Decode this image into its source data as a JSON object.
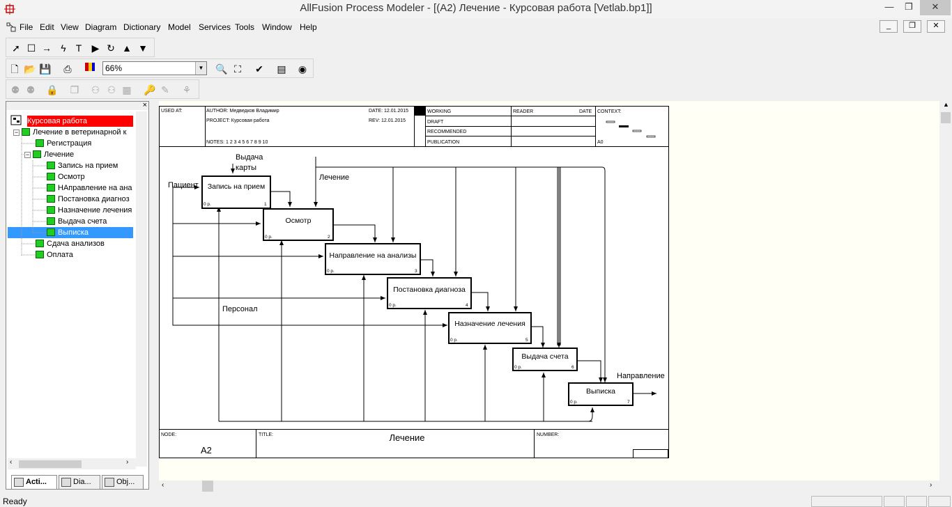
{
  "window": {
    "title": "AllFusion Process Modeler - [(A2) Лечение - Курсовая работа  [Vetlab.bp1]]",
    "minimize": "—",
    "restore": "❐",
    "close": "✕"
  },
  "menu": {
    "items": [
      "File",
      "Edit",
      "View",
      "Diagram",
      "Dictionary",
      "Model",
      "Services",
      "Tools",
      "Window",
      "Help"
    ]
  },
  "mdi": {
    "minimize": "_",
    "restore": "❐",
    "close": "✕"
  },
  "toolbar": {
    "zoom_value": "66%"
  },
  "left_panel": {
    "close": "×",
    "tree": [
      "Курсовая работа",
      "Лечение в ветеринарной к",
      "Регистрация",
      "Лечение",
      "Запись на прием",
      "Осмотр",
      "НАправление на ана",
      "Постановка диагноз",
      "Назначение лечения",
      "Выдача счета",
      "Выписка",
      "Сдача анализов",
      "Оплата"
    ],
    "tabs": [
      "Acti...",
      "Dia...",
      "Obj..."
    ]
  },
  "diagram": {
    "header": {
      "used_at": "USED AT:",
      "author": "AUTHOR: Медведков Владимир",
      "project": "PROJECT: Курсовая работа",
      "notes": "NOTES: 1 2 3 4 5 6 7 8 9 10",
      "date": "DATE: 12.01.2015",
      "rev": "REV: 12.01.2015",
      "working": "WORKING",
      "draft": "DRAFT",
      "recommended": "RECOMMENDED",
      "publication": "PUBLICATION",
      "reader": "READER",
      "date2": "DATE",
      "context": "CONTEXT:",
      "context_node": "A0"
    },
    "boxes": [
      {
        "name": "Запись на прием",
        "cost": "0 р.",
        "num": "1"
      },
      {
        "name": "Осмотр",
        "cost": "0 р.",
        "num": "2"
      },
      {
        "name": "Направление на анализы",
        "cost": "0 р.",
        "num": "3"
      },
      {
        "name": "Постановка диагноза",
        "cost": "0 р.",
        "num": "4"
      },
      {
        "name": "Назначение лечения",
        "cost": "0 р.",
        "num": "5"
      },
      {
        "name": "Выдача счета",
        "cost": "0 р.",
        "num": "6"
      },
      {
        "name": "Выписка",
        "cost": "0 р.",
        "num": "7"
      }
    ],
    "arrow_labels": {
      "vydacha": "Выдача",
      "karty": "карты",
      "patient": "Пациент",
      "lechenie": "Лечение",
      "personal": "Персонал",
      "napravlenie": "Направление"
    },
    "footer": {
      "node_label": "NODE:",
      "node_value": "A2",
      "title_label": "TITLE:",
      "title_value": "Лечение",
      "number_label": "NUMBER:"
    }
  },
  "status": {
    "text": "Ready"
  }
}
